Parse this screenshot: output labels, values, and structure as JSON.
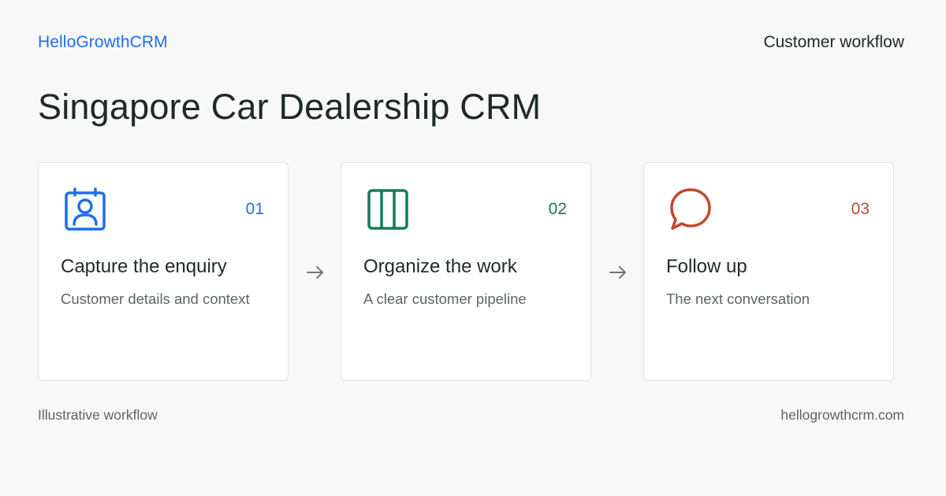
{
  "header": {
    "brand": "HelloGrowthCRM",
    "kicker": "Customer workflow"
  },
  "title": "Singapore Car Dealership CRM",
  "steps": [
    {
      "number": "01",
      "title": "Capture the enquiry",
      "description": "Customer details and context",
      "icon": "contact-card-icon",
      "color": "#1f6feb"
    },
    {
      "number": "02",
      "title": "Organize the work",
      "description": "A clear customer pipeline",
      "icon": "kanban-columns-icon",
      "color": "#17795f"
    },
    {
      "number": "03",
      "title": "Follow up",
      "description": "The next conversation",
      "icon": "chat-bubble-icon",
      "color": "#c0492f"
    }
  ],
  "connector_icon": "arrow-right-icon",
  "footer": {
    "note": "Illustrative workflow",
    "site": "hellogrowthcrm.com"
  }
}
